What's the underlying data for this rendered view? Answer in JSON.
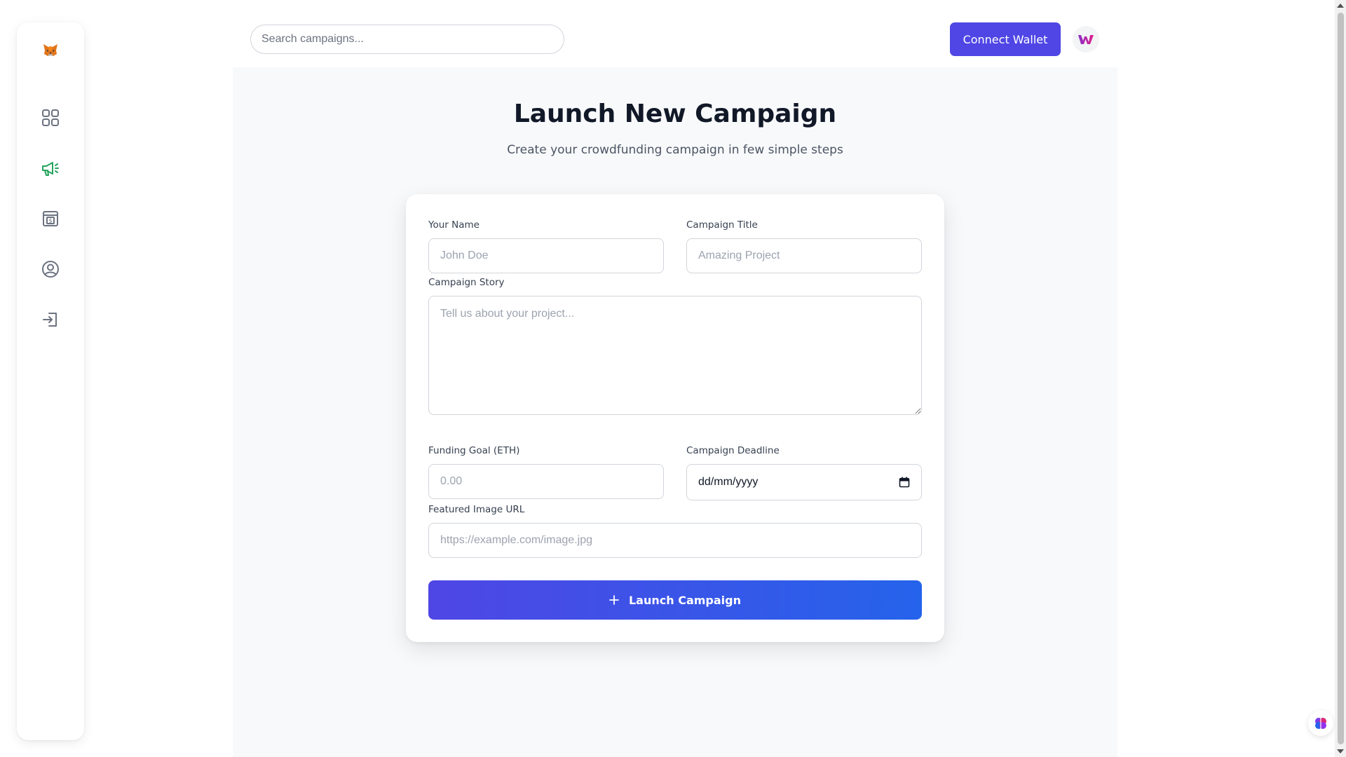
{
  "header": {
    "search_placeholder": "Search campaigns...",
    "connect_wallet_label": "Connect Wallet"
  },
  "page": {
    "title": "Launch New Campaign",
    "subtitle": "Create your crowdfunding campaign in few simple steps"
  },
  "form": {
    "name_label": "Your Name",
    "name_placeholder": "John Doe",
    "title_label": "Campaign Title",
    "title_placeholder": "Amazing Project",
    "story_label": "Campaign Story",
    "story_placeholder": "Tell us about your project...",
    "goal_label": "Funding Goal (ETH)",
    "goal_placeholder": "0.00",
    "deadline_label": "Campaign Deadline",
    "deadline_value": "dd/mm/yyyy",
    "image_label": "Featured Image URL",
    "image_placeholder": "https://example.com/image.jpg",
    "submit_label": "Launch Campaign"
  },
  "sidebar": {
    "items": [
      "dashboard-icon",
      "campaign-icon",
      "payment-icon",
      "profile-icon",
      "logout-icon"
    ]
  },
  "colors": {
    "accent": "#4f46e5",
    "accent_end": "#2563eb",
    "active_nav": "#22a45d",
    "nav_icon": "#6b7280"
  }
}
